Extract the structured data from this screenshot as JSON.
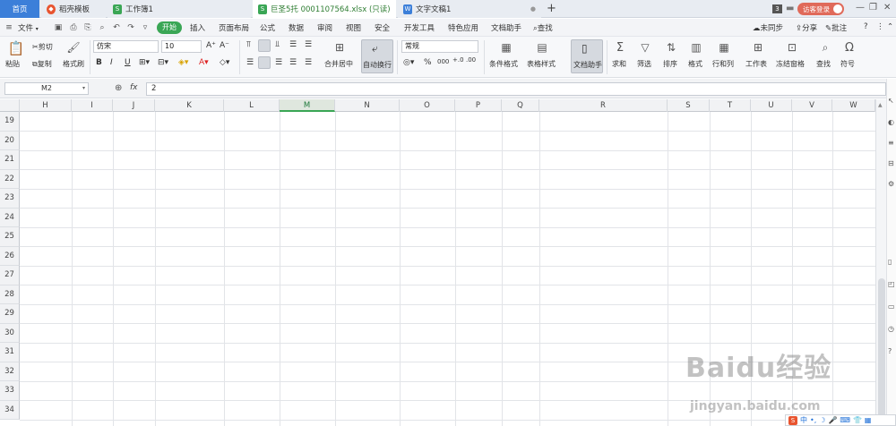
{
  "titlebar": {
    "tabs": [
      {
        "label": "首页",
        "icon": ""
      },
      {
        "label": "稻壳模板",
        "icon": "docer-icon"
      },
      {
        "label": "工作簿1",
        "icon": "S"
      },
      {
        "label": "巨圣5托 0001107564.xlsx (只读)",
        "icon": "S"
      },
      {
        "label": "文字文稿1",
        "icon": "W"
      }
    ],
    "new_tab": "+",
    "window_count": "3",
    "login_label": "访客登录"
  },
  "menubar": {
    "file_label": "文件",
    "items": [
      "开始",
      "插入",
      "页面布局",
      "公式",
      "数据",
      "审阅",
      "视图",
      "安全",
      "开发工具",
      "特色应用",
      "文档助手",
      "查找"
    ],
    "right": {
      "sync": "未同步",
      "share": "分享",
      "comment": "批注",
      "help": "?"
    }
  },
  "ribbon": {
    "paste": "粘贴",
    "cut": "剪切",
    "copy": "复制",
    "format_painter": "格式刷",
    "font_name": "仿宋",
    "font_size": "10",
    "merge_center": "合并居中",
    "wrap_text": "自动换行",
    "number_format": "常规",
    "percent": "%",
    "thousands": "000",
    "cond_format": "条件格式",
    "table_style": "表格样式",
    "doc_helper": "文档助手",
    "sum": "求和",
    "filter": "筛选",
    "sort": "排序",
    "format": "格式",
    "row_col": "行和列",
    "worksheet": "工作表",
    "freeze": "冻结窗格",
    "find": "查找",
    "symbol": "符号"
  },
  "formula_bar": {
    "name_box": "M2",
    "fx_label": "fx",
    "value": "2"
  },
  "grid": {
    "columns": [
      "H",
      "I",
      "J",
      "K",
      "L",
      "M",
      "N",
      "O",
      "P",
      "Q",
      "R",
      "S",
      "T",
      "U",
      "V",
      "W"
    ],
    "selected_column": "M",
    "rows": [
      "19",
      "20",
      "21",
      "22",
      "23",
      "24",
      "25",
      "26",
      "27",
      "28",
      "29",
      "30",
      "31",
      "32",
      "33",
      "34"
    ]
  },
  "watermark": {
    "line1": "Baidu经验",
    "line2": "jingyan.baidu.com"
  },
  "ime": {
    "label": "中"
  }
}
